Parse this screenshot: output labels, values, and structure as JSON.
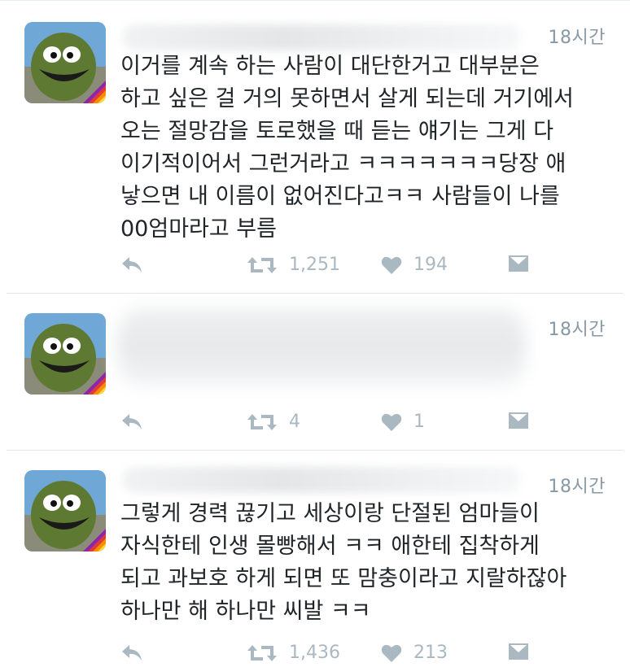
{
  "tweets": [
    {
      "time": "18시간",
      "text_lines": [
        "이거를 계속 하는 사람이 대단한거고 대부분은",
        "하고 싶은 걸 거의 못하면서 살게 되는데 거기에서",
        "오는 절망감을 토로했을 때 듣는 얘기는 그게 다",
        "이기적이어서 그런거라고 ㅋㅋㅋㅋㅋㅋㅋ당장 애",
        "낳으면 내 이름이 없어진다고ㅋㅋ 사람들이 나를",
        "00엄마라고 부름"
      ],
      "retweets": "1,251",
      "likes": "194"
    },
    {
      "time": "18시간",
      "text_lines": [],
      "retweets": "4",
      "likes": "1"
    },
    {
      "time": "18시간",
      "text_lines": [
        "그렇게 경력 끊기고 세상이랑 단절된 엄마들이",
        "자식한테 인생 몰빵해서 ㅋㅋ 애한테 집착하게",
        "되고 과보호 하게 되면 또 맘충이라고 지랄하잖아",
        "하나만 해 하나만 씨발 ㅋㅋ"
      ],
      "retweets": "1,436",
      "likes": "213"
    }
  ],
  "icons": {
    "reply": "reply-icon",
    "retweet": "retweet-icon",
    "like": "heart-icon",
    "message": "direct-message-icon"
  },
  "colors": {
    "action_gray": "#aab8c2",
    "time_gray": "#8899a6",
    "text": "#1f2428"
  }
}
